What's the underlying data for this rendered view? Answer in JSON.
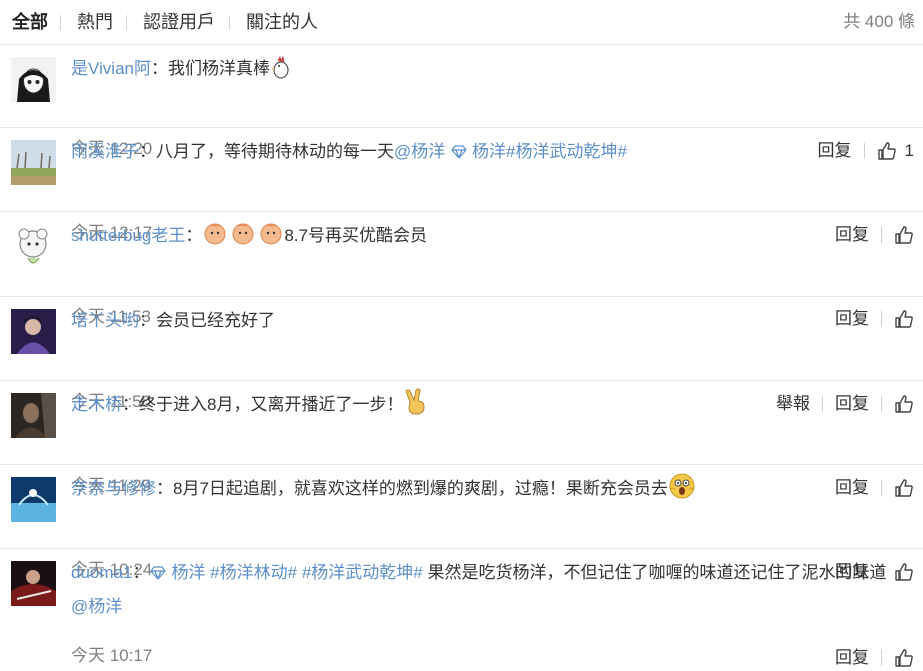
{
  "tabs": [
    {
      "label": "全部",
      "active": true
    },
    {
      "label": "熱門",
      "active": false
    },
    {
      "label": "認證用戶",
      "active": false
    },
    {
      "label": "關注的人",
      "active": false
    }
  ],
  "total_count": "共 400 條",
  "actions": {
    "reply": "回复",
    "report": "舉報"
  },
  "comments": [
    {
      "user": "是Vivian阿",
      "sep": "：",
      "text": "我们杨洋真棒",
      "emoji": "rooster-emoji",
      "time": "今天 12:20",
      "likes": "1"
    },
    {
      "user": "雨溪淮子",
      "sep": "：",
      "text": "八月了，等待期待林动的每一天",
      "mention": "@杨洋",
      "topic_name": "杨洋",
      "hashtag": "#杨洋武动乾坤#",
      "time": "今天 12:17"
    },
    {
      "user": "shutterbug老王",
      "sep": "：",
      "emoji": "baby-emoji",
      "text": "8.7号再买优酷会员",
      "time": "今天 11:53"
    },
    {
      "user": "培丫头哟",
      "sep": "：",
      "text": "会员已经充好了",
      "time": "今天 11:50",
      "has_report": true
    },
    {
      "user": "走木桥",
      "sep": "：",
      "text": "终于进入8月，又离开播近了一步！",
      "emoji": "victory-hand-emoji",
      "time": "今天 11:29"
    },
    {
      "user": "奈奈与修修",
      "sep": "：",
      "text": "8月7日起追剧，就喜欢这样的燃到爆的爽剧，过瘾！果断充会员去",
      "emoji": "scared-face-emoji",
      "time": "今天 10:24"
    },
    {
      "user": "duoma1",
      "sep": "：",
      "topic_name": "杨洋",
      "hashtag1": "#杨洋林动#",
      "hashtag2": "#杨洋武动乾坤#",
      "text": "果然是吃货杨洋，不但记住了咖喱的味道还记住了泥水的味道",
      "mention": "@杨洋",
      "time": "今天 10:17"
    }
  ],
  "icons": {
    "like": "thumbs-up-icon",
    "verified_topic": "diamond-icon"
  },
  "colors": {
    "link": "#5c8fc9",
    "text": "#333333",
    "muted": "#808080",
    "divider": "#e6e6e6"
  }
}
